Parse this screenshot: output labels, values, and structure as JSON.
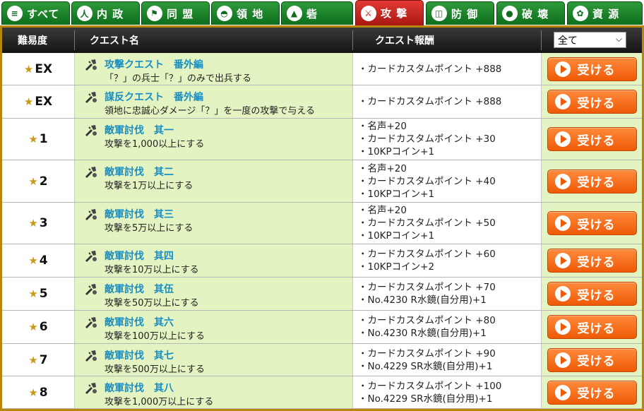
{
  "tabs": [
    {
      "label": "すべて",
      "icon": "menu-icon",
      "glyph": "≡"
    },
    {
      "label": "内 政",
      "icon": "people-icon",
      "glyph": "人"
    },
    {
      "label": "同 盟",
      "icon": "flag-icon",
      "glyph": "⚑"
    },
    {
      "label": "領 地",
      "icon": "territory-icon",
      "glyph": "◓"
    },
    {
      "label": "砦",
      "icon": "fort-icon",
      "glyph": "▲"
    },
    {
      "label": "攻 撃",
      "icon": "crossed-swords-icon",
      "glyph": "⚔"
    },
    {
      "label": "防 御",
      "icon": "shield-icon",
      "glyph": "◫"
    },
    {
      "label": "破 壊",
      "icon": "bomb-icon",
      "glyph": "●"
    },
    {
      "label": "資 源",
      "icon": "wheat-icon",
      "glyph": "✿"
    }
  ],
  "active_tab": 5,
  "colors": {
    "tab_green": "#0d6d1c",
    "tab_active_red": "#c22a22",
    "frame_gold": "#b8860b",
    "row_green": "#e3f4c2",
    "title_blue": "#1a8ec4",
    "button_orange": "#f26b14",
    "star_gold": "#c99a1a"
  },
  "header": {
    "difficulty": "難易度",
    "quest_name": "クエスト名",
    "reward": "クエスト報酬",
    "filter_value": "全て"
  },
  "accept_label": "受ける",
  "quests": [
    {
      "difficulty": "EX",
      "title": "攻撃クエスト　番外編",
      "desc": "「？」の兵士「？」のみで出兵する",
      "rewards": [
        "・カードカスタムポイント +888"
      ]
    },
    {
      "difficulty": "EX",
      "title": "謀反クエスト　番外編",
      "desc": "領地に忠誠心ダメージ「？」を一度の攻撃で与える",
      "rewards": [
        "・カードカスタムポイント +888"
      ]
    },
    {
      "difficulty": "1",
      "title": "敵軍討伐　其一",
      "desc": "攻撃を1,000以上にする",
      "rewards": [
        "・名声+20",
        "・カードカスタムポイント +30",
        "・10KPコイン+1"
      ]
    },
    {
      "difficulty": "2",
      "title": "敵軍討伐　其二",
      "desc": "攻撃を1万以上にする",
      "rewards": [
        "・名声+20",
        "・カードカスタムポイント +40",
        "・10KPコイン+1"
      ]
    },
    {
      "difficulty": "3",
      "title": "敵軍討伐　其三",
      "desc": "攻撃を5万以上にする",
      "rewards": [
        "・名声+20",
        "・カードカスタムポイント +50",
        "・10KPコイン+1"
      ]
    },
    {
      "difficulty": "4",
      "title": "敵軍討伐　其四",
      "desc": "攻撃を10万以上にする",
      "rewards": [
        "・カードカスタムポイント +60",
        "・10KPコイン+2"
      ]
    },
    {
      "difficulty": "5",
      "title": "敵軍討伐　其伍",
      "desc": "攻撃を50万以上にする",
      "rewards": [
        "・カードカスタムポイント +70",
        "・No.4230 R水鏡(自分用)+1"
      ]
    },
    {
      "difficulty": "6",
      "title": "敵軍討伐　其六",
      "desc": "攻撃を100万以上にする",
      "rewards": [
        "・カードカスタムポイント +80",
        "・No.4230 R水鏡(自分用)+1"
      ]
    },
    {
      "difficulty": "7",
      "title": "敵軍討伐　其七",
      "desc": "攻撃を500万以上にする",
      "rewards": [
        "・カードカスタムポイント +90",
        "・No.4229 SR水鏡(自分用)+1"
      ]
    },
    {
      "difficulty": "8",
      "title": "敵軍討伐　其八",
      "desc": "攻撃を1,000万以上にする",
      "rewards": [
        "・カードカスタムポイント +100",
        "・No.4229 SR水鏡(自分用)+1"
      ]
    }
  ]
}
